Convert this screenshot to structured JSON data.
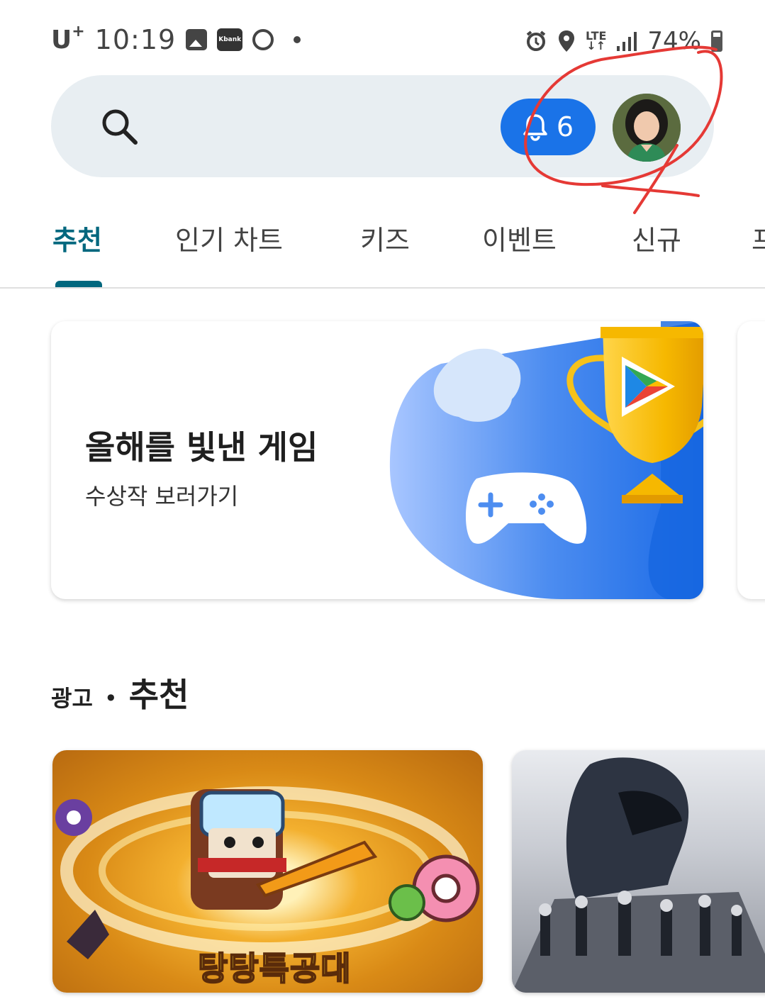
{
  "status_bar": {
    "carrier": "U",
    "carrier_sup": "+",
    "time": "10:19",
    "kbank_label": "Kbank",
    "network": "LTE",
    "battery": "74%"
  },
  "search": {
    "notification_count": "6"
  },
  "tabs": [
    {
      "label": "추천"
    },
    {
      "label": "인기 차트"
    },
    {
      "label": "키즈"
    },
    {
      "label": "이벤트"
    },
    {
      "label": "신규"
    },
    {
      "label": "프"
    }
  ],
  "banner": {
    "title": "올해를 빛낸 게임",
    "subtitle": "수상작 보러가기"
  },
  "section": {
    "ad_label": "광고",
    "separator": "•",
    "title": "추천"
  },
  "cards": [
    {
      "art_title": "탕탕특공대"
    },
    {
      "art_title": ""
    }
  ],
  "colors": {
    "accent": "#01677e",
    "notification_pill": "#1a73e8",
    "search_bg": "#e8eef2",
    "annotation": "#e53935"
  }
}
